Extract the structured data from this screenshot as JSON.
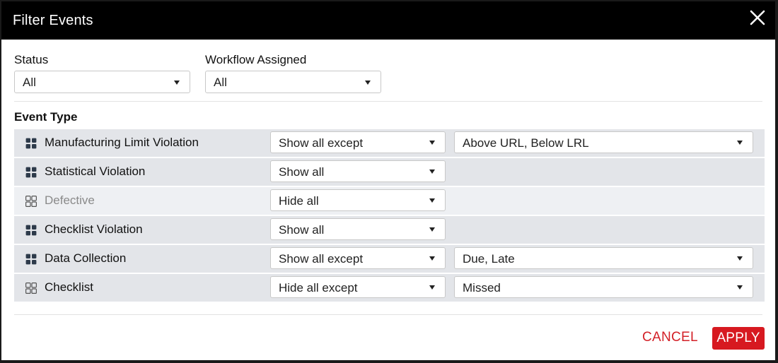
{
  "dialog": {
    "title": "Filter Events",
    "close_icon": "close-icon"
  },
  "filters": {
    "status": {
      "label": "Status",
      "value": "All"
    },
    "workflow": {
      "label": "Workflow Assigned",
      "value": "All"
    }
  },
  "event_type": {
    "title": "Event Type",
    "rows": [
      {
        "name": "Manufacturing Limit Violation",
        "mode": "Show all except",
        "detail": "Above URL, Below LRL",
        "icon": "grid-filled-icon",
        "muted": false
      },
      {
        "name": "Statistical Violation",
        "mode": "Show all",
        "detail": null,
        "icon": "grid-filled-icon",
        "muted": false
      },
      {
        "name": "Defective",
        "mode": "Hide all",
        "detail": null,
        "icon": "grid-outline-icon",
        "muted": true
      },
      {
        "name": "Checklist Violation",
        "mode": "Show all",
        "detail": null,
        "icon": "grid-filled-icon",
        "muted": false
      },
      {
        "name": "Data Collection",
        "mode": "Show all except",
        "detail": "Due, Late",
        "icon": "grid-filled-icon",
        "muted": false
      },
      {
        "name": "Checklist",
        "mode": "Hide all except",
        "detail": "Missed",
        "icon": "grid-outline-icon",
        "muted": false
      }
    ]
  },
  "footer": {
    "cancel_label": "CANCEL",
    "apply_label": "APPLY"
  },
  "colors": {
    "titlebar": "#000000",
    "accent": "#d71920",
    "row_bg": "#e3e5e9"
  }
}
